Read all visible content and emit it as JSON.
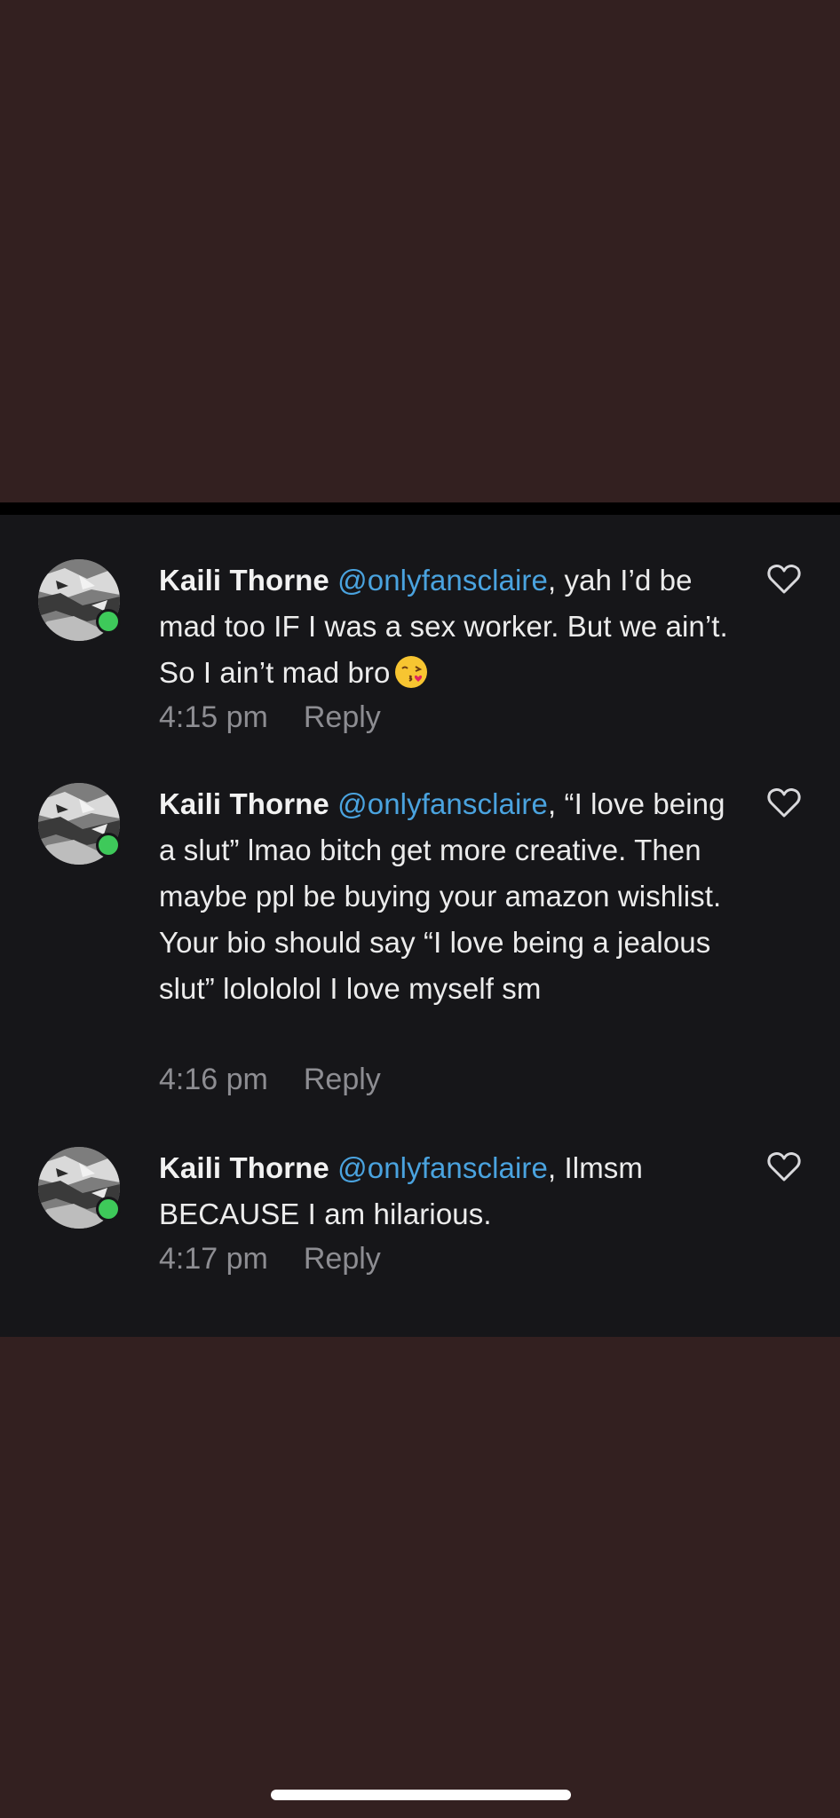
{
  "comments": [
    {
      "author": "Kaili Thorne",
      "mention": "@onlyfansclaire",
      "text": ", yah I’d be mad too IF I was a sex worker. But we ain’t. So I ain’t mad bro",
      "emoji": "face-blowing-a-kiss",
      "time": "4:15 pm",
      "reply_label": "Reply",
      "like_icon": "heart-outline-icon"
    },
    {
      "author": "Kaili Thorne",
      "mention": "@onlyfansclaire",
      "text": ", “I love being a slut” lmao bitch get more creative. Then maybe ppl be buying your amazon wishlist. Your bio should say “I love being a jealous slut” lolololol I love myself sm",
      "time": "4:16 pm",
      "reply_label": "Reply",
      "like_icon": "heart-outline-icon"
    },
    {
      "author": "Kaili Thorne",
      "mention": "@onlyfansclaire",
      "text": ", Ilmsm BECAUSE I am hilarious.",
      "time": "4:17 pm",
      "reply_label": "Reply",
      "like_icon": "heart-outline-icon"
    }
  ],
  "colors": {
    "background": "#332020",
    "panel": "#161619",
    "mention": "#4aa3df",
    "online": "#3ec95a",
    "meta": "#8d8d92"
  }
}
